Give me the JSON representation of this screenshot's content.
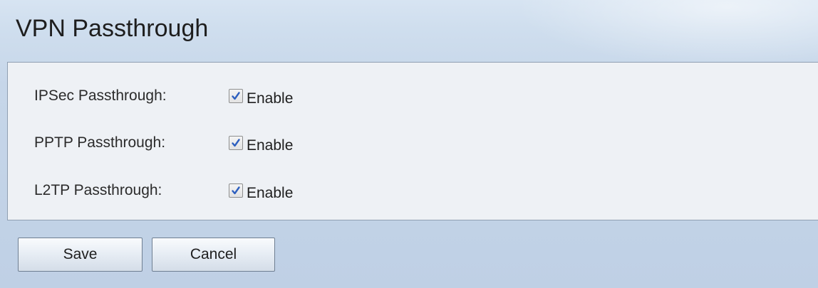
{
  "page": {
    "title": "VPN Passthrough"
  },
  "settings": [
    {
      "label": "IPSec Passthrough:",
      "option_label": "Enable",
      "checked": true
    },
    {
      "label": "PPTP Passthrough:",
      "option_label": "Enable",
      "checked": true
    },
    {
      "label": "L2TP Passthrough:",
      "option_label": "Enable",
      "checked": true
    }
  ],
  "actions": {
    "save_label": "Save",
    "cancel_label": "Cancel"
  },
  "colors": {
    "checkmark": "#2d5fbf",
    "background": "#c7d8ea",
    "panel": "#eef1f5"
  },
  "icons": {
    "checkbox_check": "checkmark-icon"
  }
}
